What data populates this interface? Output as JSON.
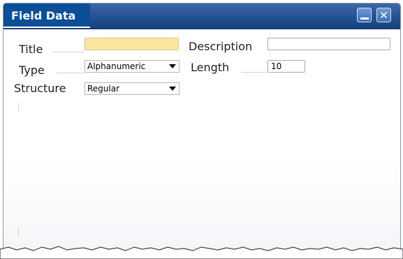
{
  "window": {
    "title": "Field Data"
  },
  "fields": {
    "title_label": "Title",
    "title_value": "",
    "description_label": "Description",
    "description_value": "",
    "type_label": "Type",
    "type_value": "Alphanumeric",
    "length_label": "Length",
    "length_value": "10",
    "structure_label": "Structure",
    "structure_value": "Regular"
  },
  "colors": {
    "title_bar": "#1f4f90",
    "title_tab": "#0b4f98",
    "mandatory_field": "#fbe6a0"
  },
  "icons": [
    "minimize-icon",
    "close-icon",
    "dropdown-arrow-icon"
  ]
}
